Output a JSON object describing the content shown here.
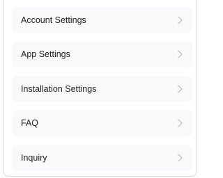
{
  "menu": {
    "items": [
      {
        "label": "Account Settings",
        "icon": "chevron-right-icon"
      },
      {
        "label": "App Settings",
        "icon": "chevron-right-icon"
      },
      {
        "label": "Installation Settings",
        "icon": "chevron-right-icon"
      },
      {
        "label": "FAQ",
        "icon": "chevron-right-icon"
      },
      {
        "label": "Inquiry",
        "icon": "chevron-right-icon"
      }
    ]
  },
  "colors": {
    "item_background": "#f9f9fb",
    "chevron": "#b5b5b5",
    "text": "#222222",
    "border": "#d9d9d9"
  }
}
